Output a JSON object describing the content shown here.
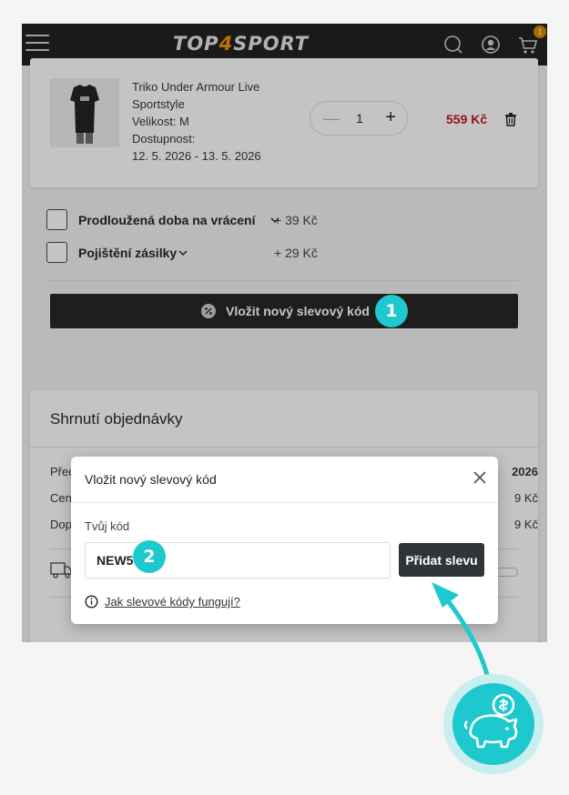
{
  "header": {
    "logo_part1": "TOP",
    "logo_part2": "4",
    "logo_part3": "SPORT",
    "cart_count": "1"
  },
  "product": {
    "name_line1": "Triko Under Armour Live",
    "name_line2": "Sportstyle",
    "size": "Velikost: M",
    "availability_label": "Dostupnost:",
    "availability_dates": "12. 5. 2026 - 13. 5. 2026",
    "quantity": "1",
    "price": "559 Kč"
  },
  "options": [
    {
      "label": "Prodloužená doba na vrácení",
      "price": "+ 39 Kč"
    },
    {
      "label": "Pojištění zásilky",
      "price": "+ 29 Kč"
    }
  ],
  "discount_button_label": "Vložit nový slevový kód",
  "summary": {
    "title": "Shrnutí objednávky",
    "rows": [
      {
        "label": "Před",
        "value": "2026"
      },
      {
        "label": "Cen",
        "value": "9 Kč"
      },
      {
        "label": "Dop",
        "value": "9 Kč"
      }
    ]
  },
  "modal": {
    "title": "Vložit nový slevový kód",
    "field_label": "Tvůj kód",
    "code_value": "NEW5",
    "submit_label": "Přidat slevu",
    "help_link": "Jak slevové kódy fungují?"
  },
  "steps": [
    "1",
    "2"
  ],
  "colors": {
    "accent": "#1ec8cf",
    "price_red": "#c1121f",
    "topbar": "#1c1c1c",
    "brand_orange": "#f29400"
  }
}
